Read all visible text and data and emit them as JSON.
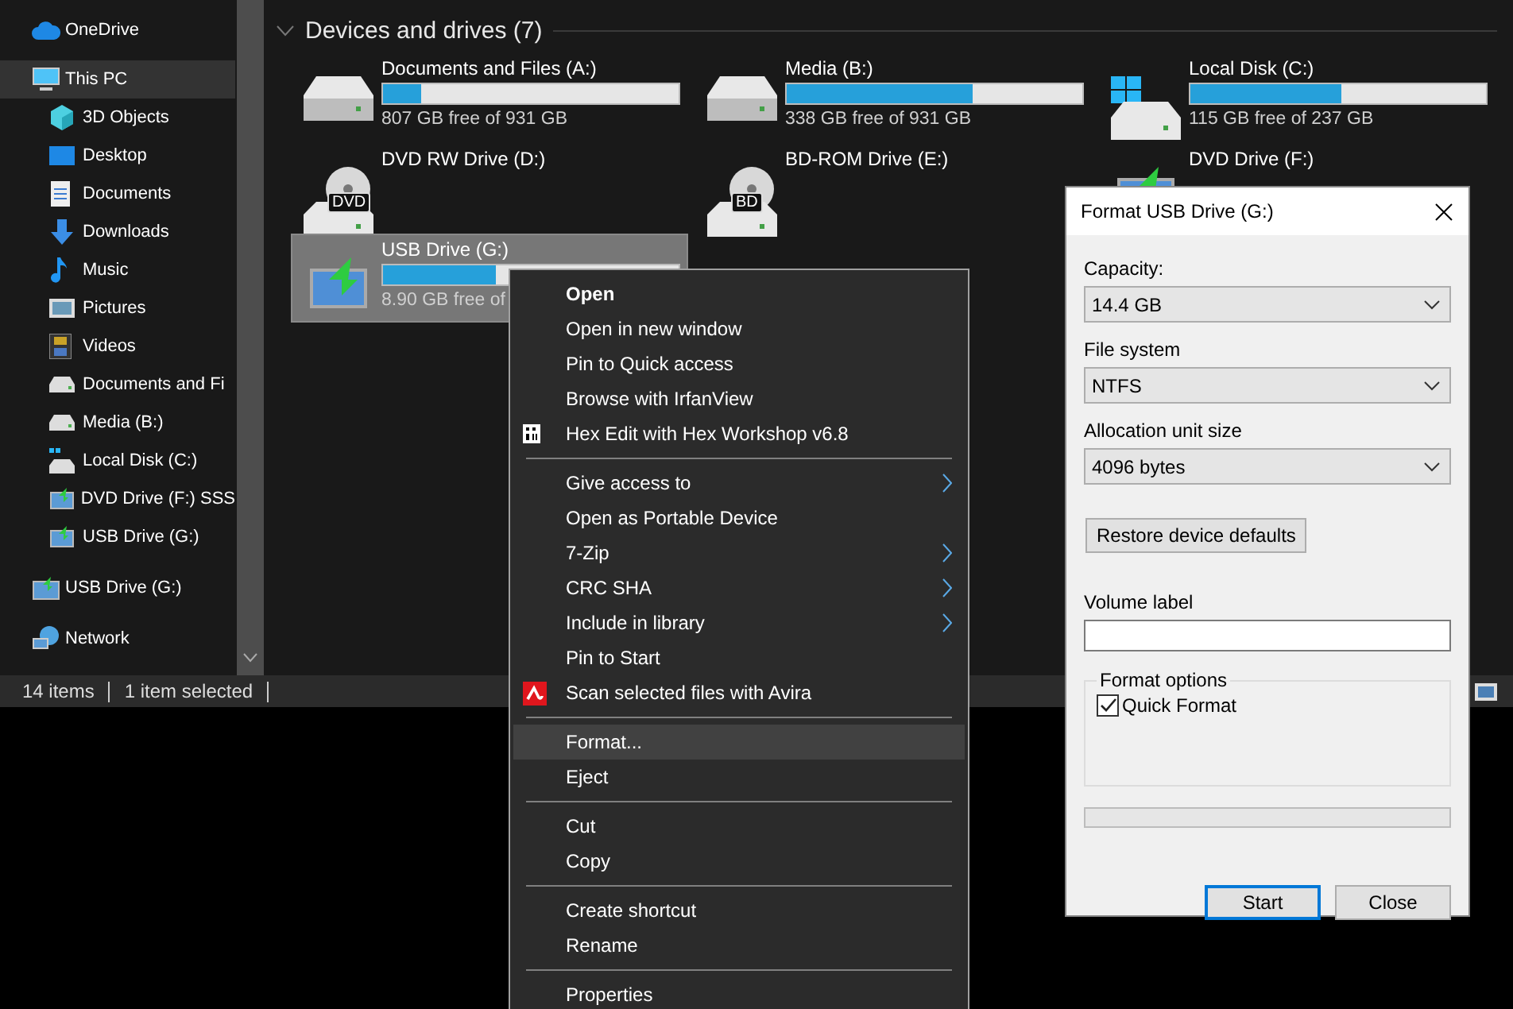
{
  "sidebar": {
    "items": [
      {
        "label": "OneDrive",
        "kind": "cloud",
        "selected": false
      },
      {
        "label": "This PC",
        "kind": "computer",
        "selected": true,
        "children": [
          {
            "label": "3D Objects",
            "kind": "cube",
            "selected": false
          },
          {
            "label": "Desktop",
            "kind": "desktop",
            "selected": false
          },
          {
            "label": "Documents",
            "kind": "document",
            "selected": false
          },
          {
            "label": "Downloads",
            "kind": "download",
            "selected": false
          },
          {
            "label": "Music",
            "kind": "music",
            "selected": false
          },
          {
            "label": "Pictures",
            "kind": "pictures",
            "selected": false
          },
          {
            "label": "Videos",
            "kind": "film",
            "selected": false
          },
          {
            "label": "Documents and Fi",
            "kind": "drive",
            "selected": false
          },
          {
            "label": "Media (B:)",
            "kind": "drive",
            "selected": false
          },
          {
            "label": "Local Disk (C:)",
            "kind": "system",
            "selected": false
          },
          {
            "label": "DVD Drive (F:) SSS",
            "kind": "usb",
            "selected": false
          },
          {
            "label": "USB Drive (G:)",
            "kind": "usb",
            "selected": false
          }
        ]
      },
      {
        "label": "USB Drive (G:)",
        "kind": "usb",
        "selected": false
      },
      {
        "label": "Network",
        "kind": "network",
        "selected": false
      }
    ]
  },
  "section": {
    "title": "Devices and drives (7)",
    "expanded": true
  },
  "drives": [
    {
      "name": "Documents and Files (A:)",
      "kind": "drive",
      "level": 0.13,
      "free": "807 GB free of 931 GB",
      "selected": false
    },
    {
      "name": "Media (B:)",
      "kind": "drive",
      "level": 0.63,
      "free": "338 GB free of 931 GB",
      "selected": false
    },
    {
      "name": "Local Disk (C:)",
      "kind": "system",
      "level": 0.51,
      "free": "115 GB free of 237 GB",
      "selected": false
    },
    {
      "name": "DVD RW Drive (D:)",
      "kind": "dvd",
      "disc_label": "DVD",
      "selected": false
    },
    {
      "name": "BD-ROM Drive (E:)",
      "kind": "dvd",
      "disc_label": "BD",
      "selected": false
    },
    {
      "name": "DVD Drive (F:)",
      "kind": "usb",
      "selected": false
    },
    {
      "name": "USB Drive (G:)",
      "kind": "usb",
      "level": 0.38,
      "free": "8.90 GB free of",
      "selected": true
    }
  ],
  "status_bar": {
    "items": [
      "14 items",
      "1 item selected"
    ]
  },
  "context_menu": {
    "groups": [
      [
        {
          "label": "Open",
          "kind": "plain",
          "default": true,
          "submenu": false,
          "selected": false
        },
        {
          "label": "Open in new window",
          "kind": "plain",
          "default": false,
          "submenu": false,
          "selected": false
        },
        {
          "label": "Pin to Quick access",
          "kind": "plain",
          "default": false,
          "submenu": false,
          "selected": false
        },
        {
          "label": "Browse with IrfanView",
          "kind": "plain",
          "default": false,
          "submenu": false,
          "selected": false
        },
        {
          "label": "Hex Edit with Hex Workshop v6.8",
          "kind": "hex",
          "default": false,
          "submenu": false,
          "selected": false
        }
      ],
      [
        {
          "label": "Give access to",
          "kind": "plain",
          "default": false,
          "submenu": true,
          "selected": false
        },
        {
          "label": "Open as Portable Device",
          "kind": "plain",
          "default": false,
          "submenu": false,
          "selected": false
        },
        {
          "label": "7-Zip",
          "kind": "plain",
          "default": false,
          "submenu": true,
          "selected": false
        },
        {
          "label": "CRC SHA",
          "kind": "plain",
          "default": false,
          "submenu": true,
          "selected": false
        },
        {
          "label": "Include in library",
          "kind": "plain",
          "default": false,
          "submenu": true,
          "selected": false
        },
        {
          "label": "Pin to Start",
          "kind": "plain",
          "default": false,
          "submenu": false,
          "selected": false
        },
        {
          "label": "Scan selected files with Avira",
          "kind": "avira",
          "default": false,
          "submenu": false,
          "selected": false
        }
      ],
      [
        {
          "label": "Format...",
          "kind": "plain",
          "default": false,
          "submenu": false,
          "selected": true
        },
        {
          "label": "Eject",
          "kind": "plain",
          "default": false,
          "submenu": false,
          "selected": false
        }
      ],
      [
        {
          "label": "Cut",
          "kind": "plain",
          "default": false,
          "submenu": false,
          "selected": false
        },
        {
          "label": "Copy",
          "kind": "plain",
          "default": false,
          "submenu": false,
          "selected": false
        }
      ],
      [
        {
          "label": "Create shortcut",
          "kind": "plain",
          "default": false,
          "submenu": false,
          "selected": false
        },
        {
          "label": "Rename",
          "kind": "plain",
          "default": false,
          "submenu": false,
          "selected": false
        }
      ],
      [
        {
          "label": "Properties",
          "kind": "plain",
          "default": false,
          "submenu": false,
          "selected": false
        }
      ]
    ]
  },
  "dialog": {
    "title": "Format USB Drive (G:)",
    "selects": [
      {
        "label": "Capacity:",
        "value": "14.4 GB"
      },
      {
        "label": "File system",
        "value": "NTFS"
      },
      {
        "label": "Allocation unit size",
        "value": "4096 bytes"
      }
    ],
    "restore_button": "Restore device defaults",
    "volume_label": {
      "label": "Volume label"
    },
    "options": {
      "title": "Format options",
      "quick_format": {
        "label": "Quick Format",
        "checked": true
      }
    },
    "progress": {
      "level": 0
    },
    "buttons": [
      {
        "label": "Start",
        "default": true
      },
      {
        "label": "Close",
        "default": false
      }
    ]
  }
}
